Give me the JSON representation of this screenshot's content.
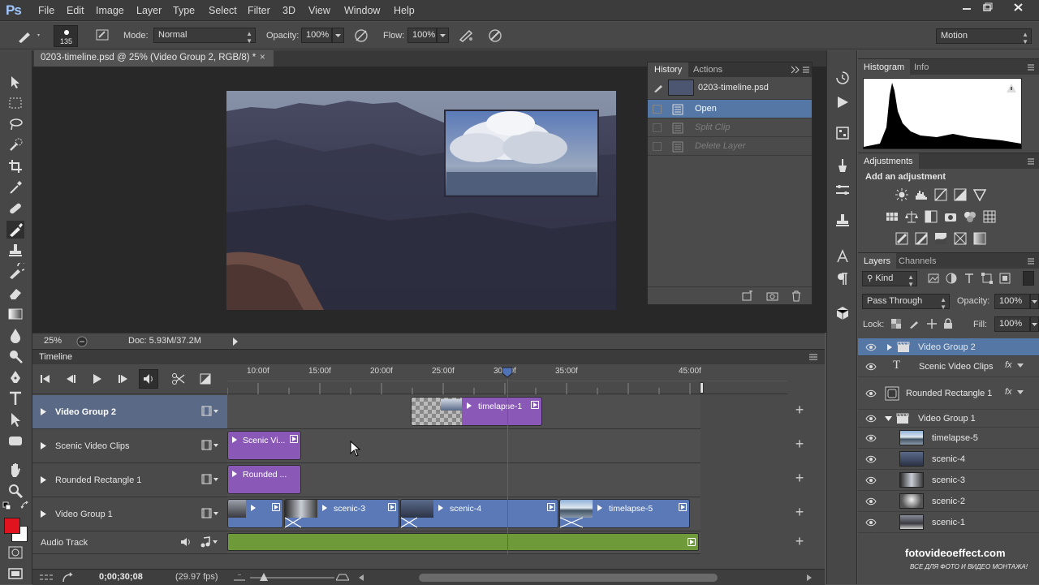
{
  "app": {
    "logo": "Ps"
  },
  "menu": [
    "File",
    "Edit",
    "Image",
    "Layer",
    "Type",
    "Select",
    "Filter",
    "3D",
    "View",
    "Window",
    "Help"
  ],
  "options": {
    "brush_size": "135",
    "mode_label": "Mode:",
    "mode_value": "Normal",
    "opacity_label": "Opacity:",
    "opacity_value": "100%",
    "flow_label": "Flow:",
    "flow_value": "100%",
    "workspace": "Motion"
  },
  "document": {
    "tab_title": "0203-timeline.psd @ 25% (Video Group 2, RGB/8) *",
    "tab_close": "×",
    "zoom": "25%",
    "doc_info": "Doc: 5.93M/37.2M"
  },
  "history": {
    "tabs": [
      "History",
      "Actions"
    ],
    "snapshot": "0203-timeline.psd",
    "items": [
      {
        "label": "Open",
        "state": "active"
      },
      {
        "label": "Split Clip",
        "state": "disabled"
      },
      {
        "label": "Delete Layer",
        "state": "disabled"
      }
    ]
  },
  "histogram": {
    "tabs": [
      "Histogram",
      "Info"
    ]
  },
  "adjustments": {
    "tab": "Adjustments",
    "heading": "Add an adjustment"
  },
  "layers_panel": {
    "tabs": [
      "Layers",
      "Channels"
    ],
    "filter": "Kind",
    "blend_mode": "Pass Through",
    "opacity_label": "Opacity:",
    "opacity_value": "100%",
    "lock_label": "Lock:",
    "fill_label": "Fill:",
    "fill_value": "100%",
    "layers": [
      {
        "name": "Video Group 2",
        "type": "group",
        "selected": true
      },
      {
        "name": "Scenic Video Clips",
        "type": "text",
        "fx": true
      },
      {
        "name": "Rounded Rectangle 1",
        "type": "shape",
        "fx": true
      },
      {
        "name": "Video Group 1",
        "type": "group-open"
      },
      {
        "name": "timelapse-5",
        "type": "video"
      },
      {
        "name": "scenic-4",
        "type": "video"
      },
      {
        "name": "scenic-3",
        "type": "video"
      },
      {
        "name": "scenic-2",
        "type": "video"
      },
      {
        "name": "scenic-1",
        "type": "video"
      }
    ],
    "fx_label": "fx"
  },
  "timeline": {
    "title": "Timeline",
    "ruler": [
      "10:00f",
      "15:00f",
      "20:00f",
      "25:00f",
      "30:00f",
      "35:00f",
      "45:00f"
    ],
    "tracks": [
      {
        "name": "Video Group 2",
        "bold": true
      },
      {
        "name": "Scenic Video Clips"
      },
      {
        "name": "Rounded Rectangle 1"
      },
      {
        "name": "Video Group 1"
      },
      {
        "name": "Audio Track"
      }
    ],
    "clips": {
      "timelapse1": "timelapse-1",
      "scenic_vi": "Scenic Vi...",
      "rounded": "Rounded ...",
      "scenic3": "scenic-3",
      "scenic4": "scenic-4",
      "timelapse5": "timelapse-5"
    },
    "timecode": "0;00;30;08",
    "fps": "(29.97 fps)",
    "plus": "+"
  },
  "watermark": {
    "line1": "fotovideoeffect.com",
    "line2": "ВСЕ ДЛЯ ФОТО И ВИДЕО МОНТАЖА!"
  },
  "colors": {
    "accent": "#5a79b6",
    "clip_purple": "#8a59b8",
    "audio_green": "#6e9a3a",
    "playhead": "#d23232",
    "foreground": "#e0141e",
    "background": "#ffffff"
  }
}
